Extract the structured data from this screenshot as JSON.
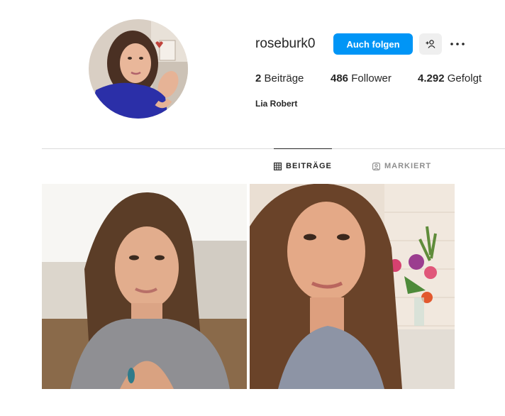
{
  "profile": {
    "username": "roseburk0",
    "full_name": "Lia Robert",
    "follow_label": "Auch folgen",
    "stats": {
      "posts_count": "2",
      "posts_label": "Beiträge",
      "followers_count": "486",
      "followers_label": "Follower",
      "following_count": "4.292",
      "following_label": "Gefolgt"
    }
  },
  "tabs": {
    "posts": "BEITRÄGE",
    "tagged": "MARKIERT"
  },
  "icons": {
    "suggest": "add-person-icon",
    "more": "more-options-icon",
    "posts_tab": "grid-icon",
    "tagged_tab": "tag-portrait-icon"
  },
  "colors": {
    "accent": "#0095f6",
    "text": "#262626",
    "muted": "#8e8e8e",
    "divider": "#dbdbdb"
  },
  "posts": [
    {
      "type": "photo"
    },
    {
      "type": "photo"
    }
  ]
}
